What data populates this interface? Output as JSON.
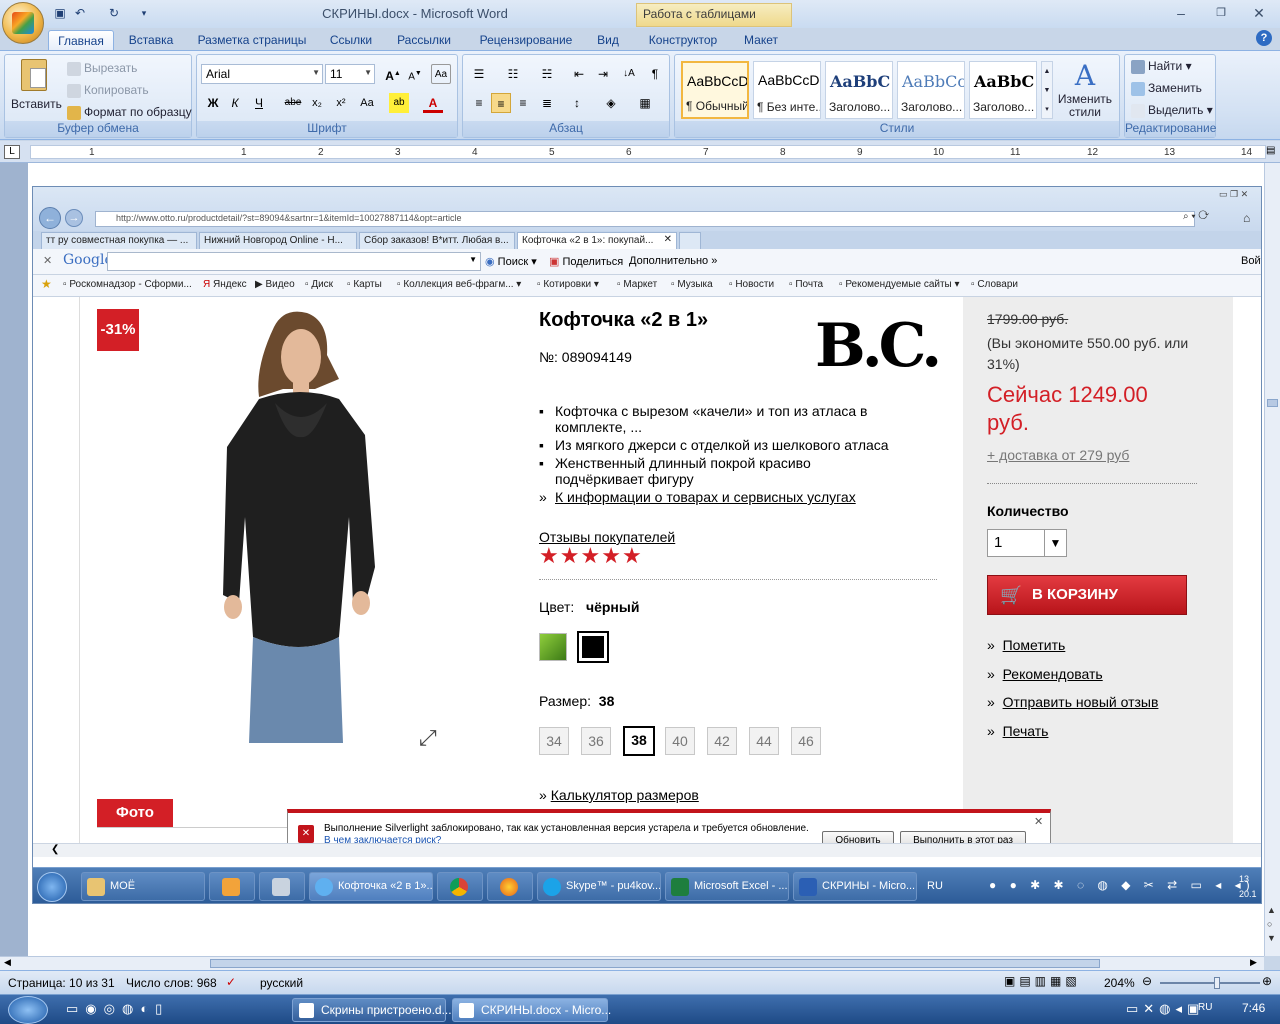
{
  "word": {
    "title": "СКРИНЫ.docx - Microsoft Word",
    "contextual_tab": "Работа с таблицами",
    "tabs": [
      "Главная",
      "Вставка",
      "Разметка страницы",
      "Ссылки",
      "Рассылки",
      "Рецензирование",
      "Вид",
      "Конструктор",
      "Макет"
    ],
    "clipboard": {
      "paste": "Вставить",
      "cut": "Вырезать",
      "copy": "Копировать",
      "format_painter": "Формат по образцу",
      "label": "Буфер обмена"
    },
    "font": {
      "name": "Arial",
      "size": "11",
      "label": "Шрифт"
    },
    "paragraph": {
      "label": "Абзац"
    },
    "styles": {
      "items": [
        {
          "sample": "AaBbCcDc",
          "name": "¶ Обычный"
        },
        {
          "sample": "AaBbCcDc",
          "name": "¶ Без инте..."
        },
        {
          "sample": "AaBbC",
          "name": "Заголово..."
        },
        {
          "sample": "AaBbCc",
          "name": "Заголово..."
        },
        {
          "sample": "AaBbC",
          "name": "Заголово..."
        }
      ],
      "change": "Изменить стили",
      "label": "Стили"
    },
    "editing": {
      "find": "Найти",
      "replace": "Заменить",
      "select": "Выделить",
      "label": "Редактирование"
    },
    "ruler_numbers": [
      "1",
      "1",
      "2",
      "3",
      "4",
      "5",
      "6",
      "7",
      "8",
      "9",
      "10",
      "11",
      "12",
      "13",
      "14"
    ],
    "status": {
      "page": "Страница: 10 из 31",
      "words": "Число слов: 968",
      "language": "русский",
      "zoom": "204%"
    },
    "taskbar": {
      "items": [
        "Скрины пристроено.d...",
        "СКРИНЫ.docx - Micro..."
      ],
      "lang": "RU",
      "time": "7:46"
    }
  },
  "screenshot": {
    "url": "http://www.otto.ru/productdetail/?st=89094&sartnr=1&itemId=10027887114&opt=article",
    "tabs": [
      "тт ру совместная покупка — ...",
      "Нижний Новгород Online - Н...",
      "Сбор заказов! B*итт. Любая в...",
      "Кофточка «2 в 1»: покупай..."
    ],
    "google": {
      "brand": "Google",
      "search": "Поиск",
      "share": "Поделиться",
      "more": "Дополнительно",
      "login": "Войт"
    },
    "favorites": [
      "Роскомнадзор - Сформи...",
      "Яндекс",
      "Видео",
      "Диск",
      "Карты",
      "Коллекция веб-фрагм...",
      "Котировки",
      "Маркет",
      "Музыка",
      "Новости",
      "Почта",
      "Рекомендуемые сайты",
      "Словари"
    ],
    "product": {
      "discount": "-31%",
      "title": "Кофточка «2 в 1»",
      "number": "№: 089094149",
      "brand": "B.C.",
      "bullets": [
        "Кофточка с вырезом «качели» и топ из атласа в комплекте, ...",
        "Из мягкого джерси с отделкой из шелкового атласа",
        "Женственный длинный покрой красиво подчёркивает фигуру"
      ],
      "info_link": "К информации о товарах и сервисных услугах",
      "reviews": "Отзывы покупателей",
      "rating_stars": 5,
      "color_label": "Цвет:",
      "color_value": "чёрный",
      "size_label": "Размер:",
      "size_value": "38",
      "sizes": [
        "34",
        "36",
        "38",
        "40",
        "42",
        "44",
        "46"
      ],
      "size_calc": "Калькулятор размеров",
      "photo_tab": "Фото",
      "old_price": "1799.00 руб.",
      "savings": "(Вы экономите 550.00 руб. или 31%)",
      "new_price": "Сейчас 1249.00 руб.",
      "delivery": "+ доставка от 279 руб",
      "qty_label": "Количество",
      "qty_value": "1",
      "cart": "В КОРЗИНУ",
      "links": [
        "Пометить",
        "Рекомендовать",
        "Отправить новый отзыв",
        "Печать"
      ]
    },
    "silverlight": {
      "message": "Выполнение Silverlight заблокировано, так как установленная версия устарела и требуется обновление.",
      "risk": "В чем заключается риск?",
      "update": "Обновить",
      "run_once": "Выполнить в этот раз"
    },
    "taskbar": {
      "items": [
        "МОЁ",
        "Кофточка «2 в 1»...",
        "Skype™ - pu4kov...",
        "Microsoft Excel - ...",
        "СКРИНЫ - Micro..."
      ],
      "lang": "RU",
      "time_partial": "13",
      "date_partial": "20.1"
    }
  },
  "colors": {
    "accent_red": "#d31f26",
    "ribbon_blue": "#15428b"
  }
}
